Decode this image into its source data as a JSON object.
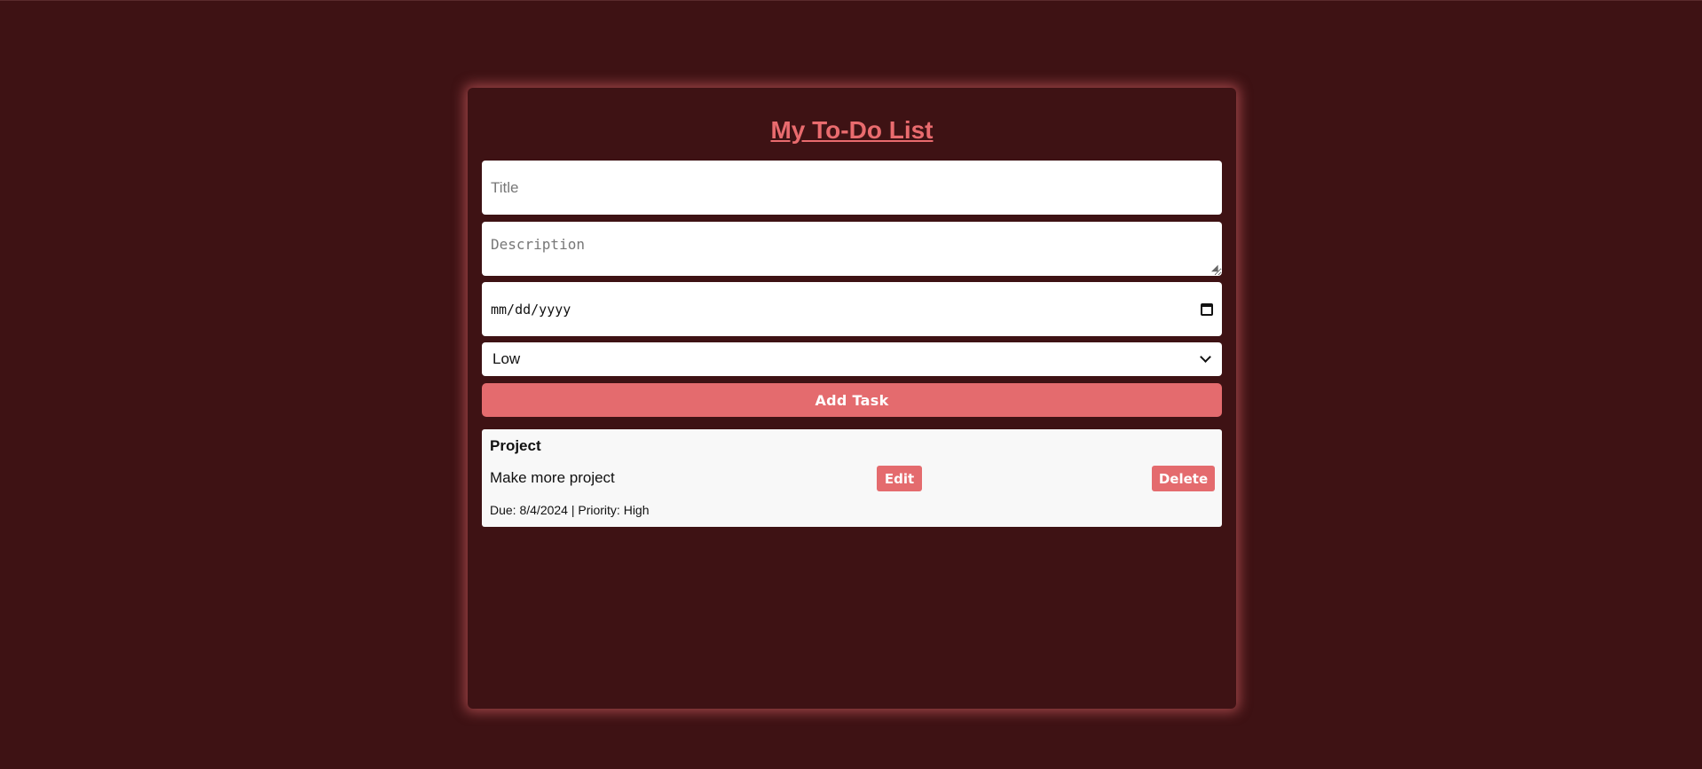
{
  "header": {
    "title": "My To-Do List"
  },
  "form": {
    "title_placeholder": "Title",
    "description_placeholder": "Description",
    "date_placeholder": "mm/dd/yyyy",
    "priority_selected": "Low",
    "add_button_label": "Add Task"
  },
  "tasks": [
    {
      "title": "Project",
      "description": "Make more project",
      "edit_label": "Edit",
      "delete_label": "Delete",
      "meta": "Due: 8/4/2024 | Priority: High"
    }
  ],
  "colors": {
    "background": "#3e1214",
    "accent": "#e46b6e",
    "card": "#f8f8f8"
  }
}
